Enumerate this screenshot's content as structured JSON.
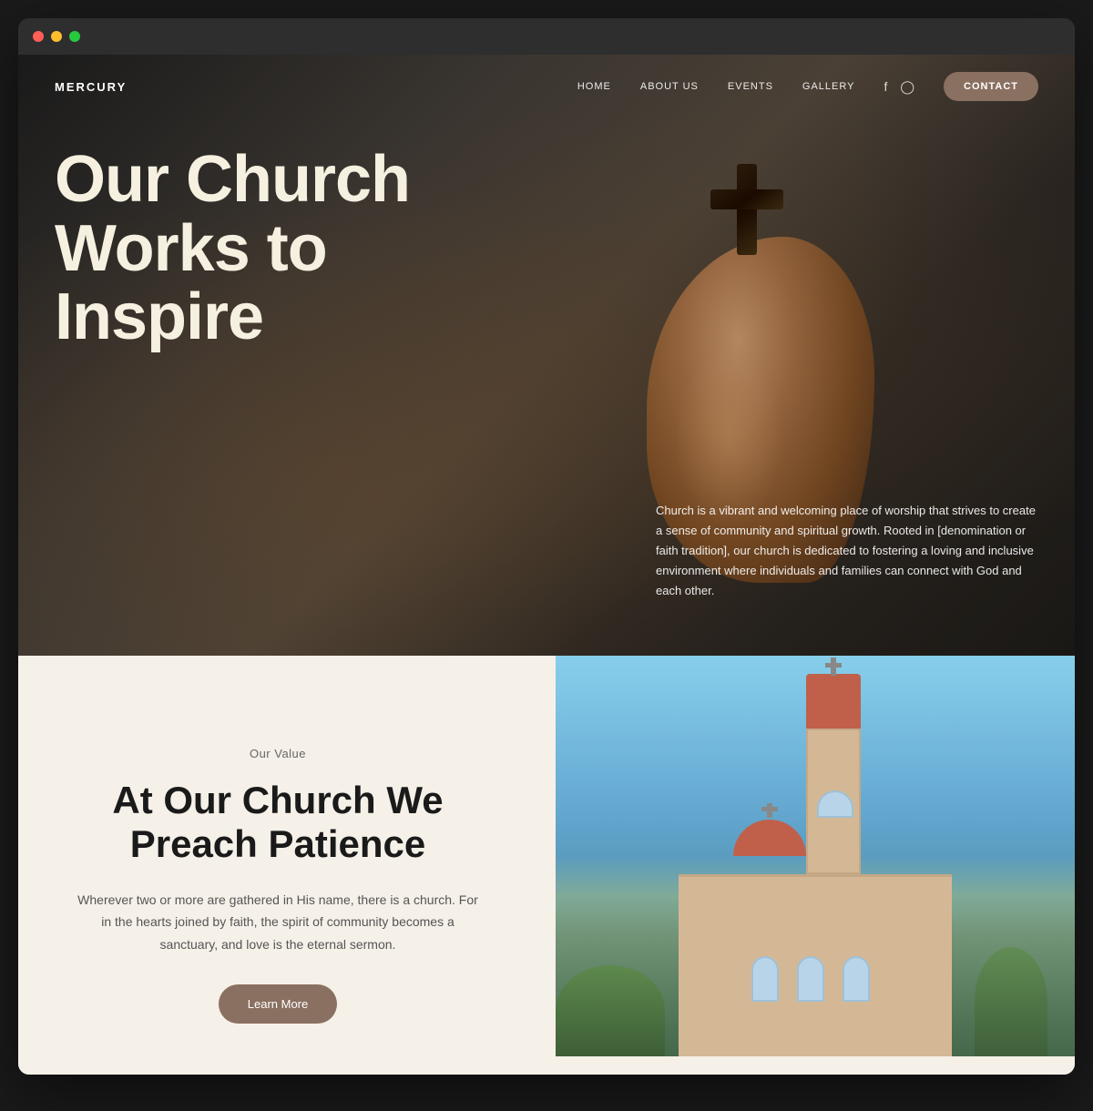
{
  "browser": {
    "traffic_lights": [
      "red",
      "yellow",
      "green"
    ]
  },
  "site": {
    "logo": "MERCURY",
    "nav": {
      "links": [
        "HOME",
        "ABOUT US",
        "EVENTS",
        "GALLERY"
      ],
      "social": [
        "f",
        "○"
      ],
      "contact_button": "CONTACT"
    },
    "hero": {
      "headline_line1": "Our Church",
      "headline_line2": "Works to",
      "headline_line3": "Inspire",
      "description": "Church is a vibrant and welcoming place of worship that strives to create a sense of community and spiritual growth. Rooted in [denomination or faith tradition], our church is dedicated to fostering a loving and inclusive environment where individuals and families can connect with God and each other."
    },
    "second_section": {
      "label": "Our Value",
      "title_line1": "At Our Church We",
      "title_line2": "Preach Patience",
      "body": "Wherever two or more are gathered in His name, there is a church. For in the hearts joined by faith, the spirit of community becomes a sanctuary, and love is the eternal sermon.",
      "button_label": "Learn More"
    }
  }
}
